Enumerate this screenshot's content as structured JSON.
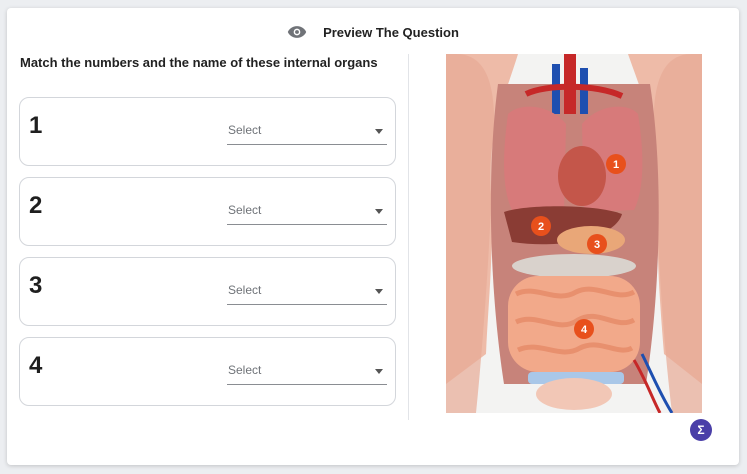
{
  "header": {
    "title": "Preview The Question",
    "icon": "eye-icon"
  },
  "question": {
    "prompt": "Match the numbers and the name of these internal organs"
  },
  "rows": [
    {
      "number": "1",
      "placeholder": "Select"
    },
    {
      "number": "2",
      "placeholder": "Select"
    },
    {
      "number": "3",
      "placeholder": "Select"
    },
    {
      "number": "4",
      "placeholder": "Select"
    }
  ],
  "figure": {
    "markers": [
      "1",
      "2",
      "3",
      "4"
    ],
    "marker_color": "#e8501c"
  },
  "footer": {
    "sigma_label": "Σ",
    "sigma_color": "#4a3fa8"
  }
}
